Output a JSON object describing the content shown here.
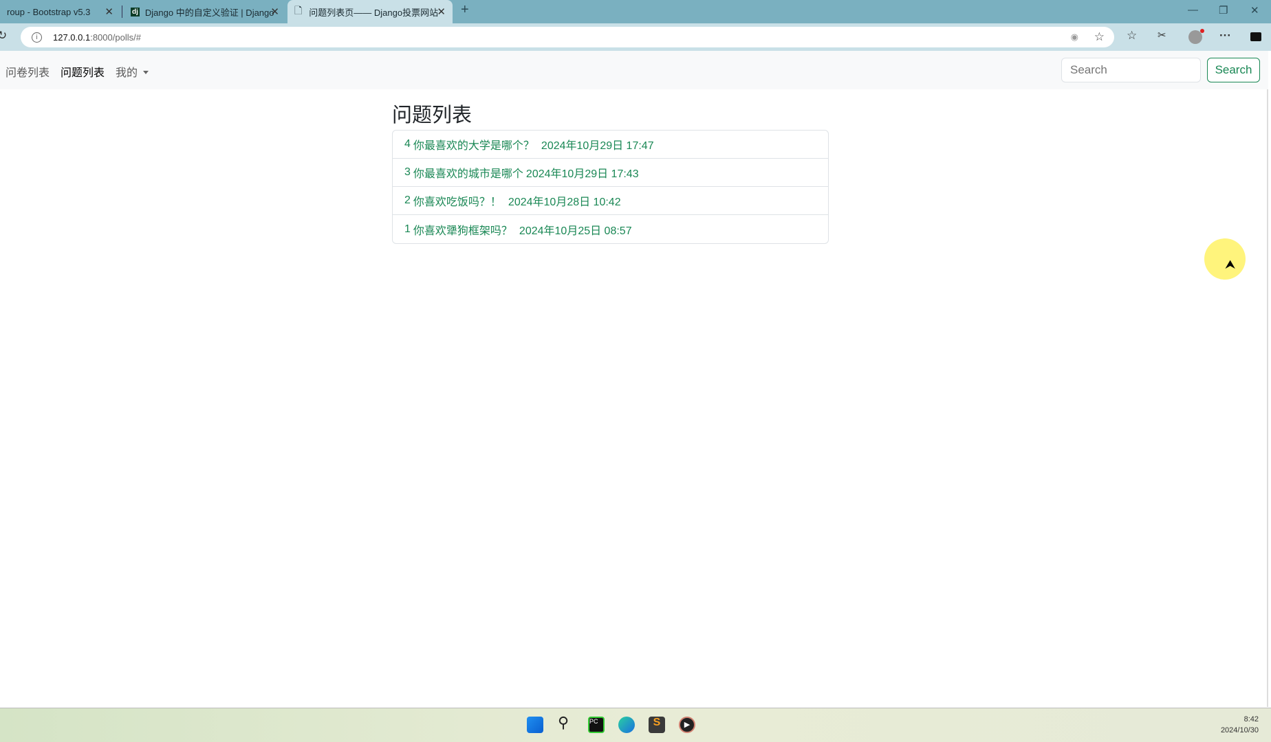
{
  "browser": {
    "tabs": [
      {
        "title": "roup - Bootstrap v5.3"
      },
      {
        "title": "Django 中的自定义验证 | Django",
        "icon": "dj"
      },
      {
        "title": "问题列表页—— Django投票网站",
        "active": true
      }
    ],
    "url_host": "127.0.0.1",
    "url_rest": ":8000/polls/#"
  },
  "navbar": {
    "links": [
      {
        "label": "问卷列表"
      },
      {
        "label": "问题列表",
        "active": true
      },
      {
        "label": "我的"
      }
    ],
    "search_placeholder": "Search",
    "search_button": "Search",
    "accent": "#198754"
  },
  "main": {
    "title": "问题列表",
    "questions": [
      {
        "id": "4",
        "text": "你最喜欢的大学是哪个？",
        "date": "2024年10月29日 17:47"
      },
      {
        "id": "3",
        "text": "你最喜欢的城市是哪个",
        "date": "2024年10月29日 17:43"
      },
      {
        "id": "2",
        "text": "你喜欢吃饭吗？！",
        "date": "2024年10月28日 10:42"
      },
      {
        "id": "1",
        "text": "你喜欢犟狗框架吗？",
        "date": "2024年10月25日 08:57"
      }
    ]
  },
  "taskbar": {
    "time": "8:42",
    "date": "2024/10/30"
  }
}
